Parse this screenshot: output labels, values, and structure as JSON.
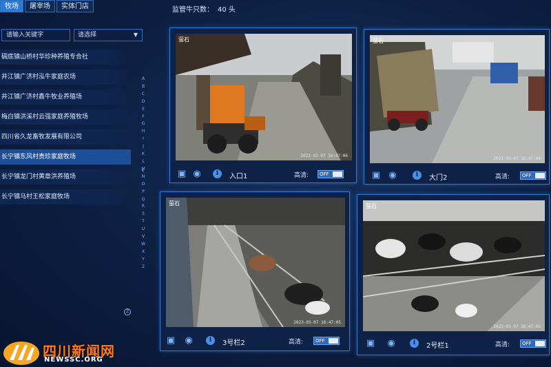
{
  "tabs": [
    {
      "label": "牧场",
      "active": true
    },
    {
      "label": "屠宰场",
      "active": false
    },
    {
      "label": "实体门店",
      "active": false
    }
  ],
  "monitor": {
    "label": "监管牛只数：",
    "value": "40 头"
  },
  "search": {
    "placeholder": "请输入关键字"
  },
  "filter": {
    "value": "请选择"
  },
  "farms": [
    "碉底镇山桥村华珍种养殖专合社",
    "井江镇广济村泓牛家庭农场",
    "井江镇广济村鑫牛牧业养殖场",
    "梅白镇洪溪村云强家庭养殖牧场",
    "四川省久龙畜牧发展有限公司",
    "长宁镇东风村贵珍家庭牧场",
    "长宁镇龙门村黄章洪养殖场",
    "长宁镇马村王松家庭牧场"
  ],
  "selected_farm_index": 5,
  "alphabet": [
    "A",
    "B",
    "C",
    "D",
    "E",
    "F",
    "G",
    "H",
    "I",
    "J",
    "K",
    "L",
    "M",
    "N",
    "O",
    "P",
    "Q",
    "R",
    "S",
    "T",
    "U",
    "V",
    "W",
    "X",
    "Y",
    "Z"
  ],
  "alpha_circle": "Z",
  "cameras": [
    {
      "name": "入口1",
      "timestamp": "2023-03-07 16:47:06",
      "brand": "萤石",
      "hd_label": "高清:",
      "hd_state": "OFF"
    },
    {
      "name": "大门2",
      "timestamp": "2023-03-07 16:47:04",
      "brand": "萤石",
      "hd_label": "高清:",
      "hd_state": "OFF"
    },
    {
      "name": "3号栏2",
      "timestamp": "2023-03-07 16:47:05",
      "brand": "萤石",
      "hd_label": "高清:",
      "hd_state": "OFF"
    },
    {
      "name": "2号栏1",
      "timestamp": "2023-03-07 16:47:05",
      "brand": "萤石",
      "hd_label": "高清:",
      "hd_state": "OFF"
    }
  ],
  "watermark": {
    "title": "四川新闻网",
    "url": "NEWSSC.ORG"
  },
  "colors": {
    "accent": "#2c78d8",
    "background": "#0b1a36",
    "watermark": "#ff7a1a"
  }
}
